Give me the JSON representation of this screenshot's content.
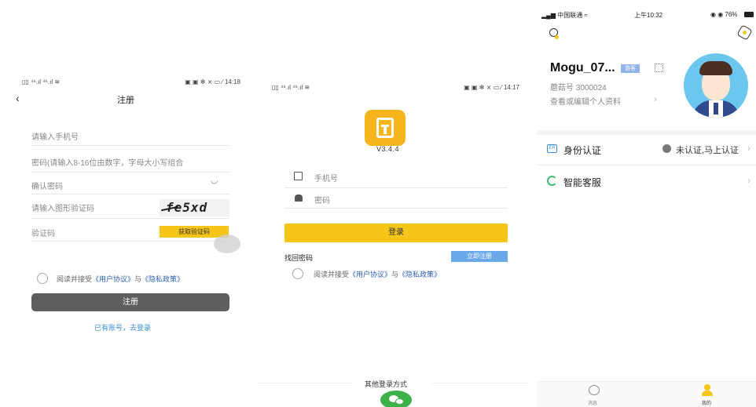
{
  "register": {
    "status_left": "▯▯ ⁴⁶.ıl ⁴⁶.ıl ≋",
    "status_right": "▣ ▣ ✻ ⨯ ▭ ⁄ 14:18",
    "title": "注册",
    "phone_placeholder": "请输入手机号",
    "password_placeholder": "密码(请输入8-16位由数字，字母大小写组合",
    "confirm_placeholder": "确认密码",
    "captcha_placeholder": "请输入图形验证码",
    "captcha_text": "fe5xd",
    "sms_placeholder": "验证码",
    "sms_button": "获取验证码",
    "agree_prefix": "阅读并接受",
    "agree_terms": "《用户协议》",
    "agree_and": "与",
    "agree_privacy": "《隐私政策》",
    "submit": "注册",
    "login_link": "已有账号，去登录"
  },
  "login": {
    "status_left": "▯▯ ⁴⁶.ıl ⁴⁶.ıl ≋",
    "status_right": "▣ ▣ ✻ ⨯ ▭ ⁄ 14:17",
    "version": "V3.4.4",
    "phone_placeholder": "手机号",
    "password_placeholder": "密码",
    "submit": "登录",
    "forgot": "找回密码",
    "register_now": "立即注册",
    "agree_prefix": "阅读并接受",
    "agree_terms": "《用户协议》",
    "agree_and": "与",
    "agree_privacy": "《隐私政策》",
    "other_methods": "其他登录方式"
  },
  "profile": {
    "carrier": "中国联通",
    "time": "上午10:32",
    "battery": "76%",
    "username": "Mogu_07...",
    "guest_badge": "游客",
    "user_id": "蘑菇号 3000024",
    "edit_profile": "查看或编辑个人资料",
    "verify_label": "身份认证",
    "verify_status": "未认证,马上认证",
    "service_label": "智能客服",
    "tab_messages": "消息",
    "tab_mine": "我的",
    "accent_color": "#f5c518"
  }
}
